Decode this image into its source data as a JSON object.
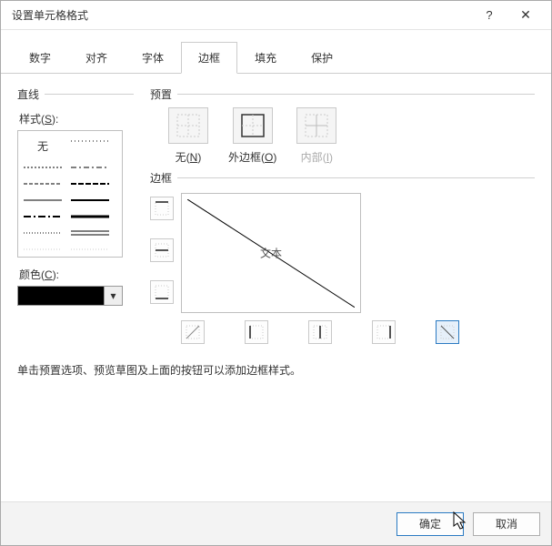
{
  "title": "设置单元格格式",
  "tabs": [
    "数字",
    "对齐",
    "字体",
    "边框",
    "填充",
    "保护"
  ],
  "line": {
    "group": "直线",
    "style_label_pre": "样式",
    "style_key": "S",
    "none": "无",
    "color_label_pre": "颜色",
    "color_key": "C",
    "color_value": "#000000"
  },
  "presets": {
    "group": "预置",
    "none_pre": "无",
    "none_key": "N",
    "outline_pre": "外边框",
    "outline_key": "O",
    "inside_pre": "内部",
    "inside_key": "I"
  },
  "border": {
    "group": "边框",
    "preview_text": "文本",
    "selected": "diag-down"
  },
  "hint": "单击预置选项、预览草图及上面的按钮可以添加边框样式。",
  "footer": {
    "ok": "确定",
    "cancel": "取消"
  }
}
